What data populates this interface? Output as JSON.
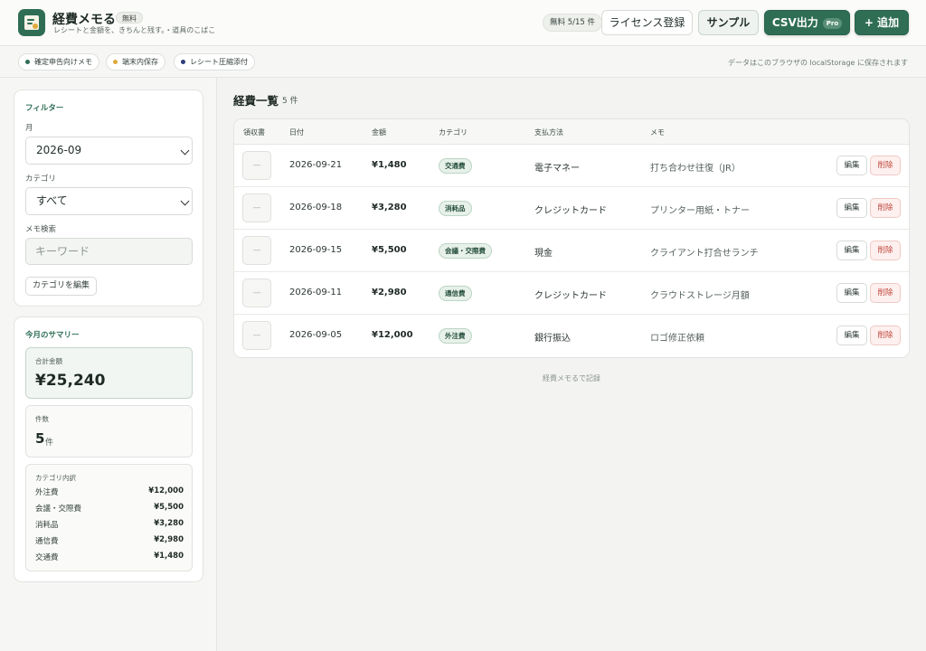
{
  "header": {
    "app_title": "経費メモる",
    "free_badge": "無料",
    "tagline": "レシートと金額を、きちんと残す。・道具のこばこ",
    "usage": "無料 5/15 件",
    "license_label": "ライセンス登録",
    "sample_label": "サンプル",
    "csv_label": "CSV出力",
    "pro_badge": "Pro",
    "add_label": "+ 追加"
  },
  "subbar": {
    "chips": [
      {
        "label": "確定申告向けメモ",
        "color": "#2f6e55"
      },
      {
        "label": "端末内保存",
        "color": "#e0a93a"
      },
      {
        "label": "レシート圧縮添付",
        "color": "#2d3e7a"
      }
    ],
    "storage_note": "データはこのブラウザの localStorage に保存されます"
  },
  "filter": {
    "title": "フィルター",
    "month_label": "月",
    "month_value": "2026-09",
    "category_label": "カテゴリ",
    "category_value": "すべて",
    "search_label": "メモ検索",
    "search_placeholder": "キーワード",
    "edit_categories_label": "カテゴリを編集"
  },
  "summary": {
    "title": "今月のサマリー",
    "total_label": "合計金額",
    "total_value": "¥25,240",
    "count_label": "件数",
    "count_value": "5",
    "count_unit": "件",
    "breakdown_label": "カテゴリ内訳",
    "breakdown": [
      {
        "name": "外注費",
        "amount": "¥12,000"
      },
      {
        "name": "会議・交際費",
        "amount": "¥5,500"
      },
      {
        "name": "消耗品",
        "amount": "¥3,280"
      },
      {
        "name": "通信費",
        "amount": "¥2,980"
      },
      {
        "name": "交通費",
        "amount": "¥1,480"
      }
    ]
  },
  "list": {
    "title": "経費一覧",
    "count": "5 件",
    "columns": {
      "receipt": "領収書",
      "date": "日付",
      "amount": "金額",
      "category": "カテゴリ",
      "payment": "支払方法",
      "memo": "メモ"
    },
    "edit_label": "編集",
    "delete_label": "削除",
    "receipt_empty": "—",
    "rows": [
      {
        "date": "2026-09-21",
        "amount": "¥1,480",
        "category": "交通費",
        "payment": "電子マネー",
        "memo": "打ち合わせ往復（JR）"
      },
      {
        "date": "2026-09-18",
        "amount": "¥3,280",
        "category": "消耗品",
        "payment": "クレジットカード",
        "memo": "プリンター用紙・トナー"
      },
      {
        "date": "2026-09-15",
        "amount": "¥5,500",
        "category": "会議・交際費",
        "payment": "現金",
        "memo": "クライアント打合せランチ"
      },
      {
        "date": "2026-09-11",
        "amount": "¥2,980",
        "category": "通信費",
        "payment": "クレジットカード",
        "memo": "クラウドストレージ月額"
      },
      {
        "date": "2026-09-05",
        "amount": "¥12,000",
        "category": "外注費",
        "payment": "銀行振込",
        "memo": "ロゴ修正依頼"
      }
    ]
  },
  "footer": "経費メモるで記録"
}
